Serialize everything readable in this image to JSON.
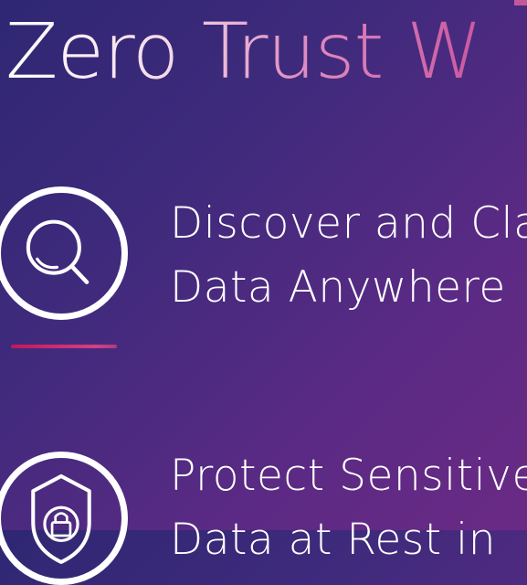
{
  "title": "Zero Trust W",
  "features": [
    {
      "icon": "magnifier-icon",
      "line1": "Discover and Cla",
      "line2": "Data Anywhere"
    },
    {
      "icon": "shield-lock-icon",
      "line1": "Protect Sensitive",
      "line2": "Data at Rest in"
    }
  ],
  "colors": {
    "background_start": "#2f2773",
    "background_end": "#6a2a85",
    "accent": "#c2185b",
    "title_gradient_end": "#c8589f"
  }
}
